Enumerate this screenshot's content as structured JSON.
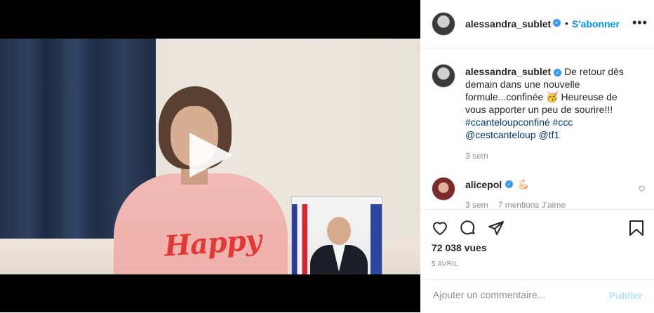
{
  "post": {
    "username": "alessandra_sublet",
    "follow_label": "S'abonner",
    "separator": "•",
    "more_label": "•••",
    "verified_glyph": "✓",
    "caption_text": "De retour dès demain dans une nouvelle formule...confinée 🥳 Heureuse de vous apporter un peu de sourire!!!",
    "caption_tags": "#ccanteloupconfiné #ccc @cestcanteloup @tf1",
    "caption_time": "3 sem"
  },
  "video": {
    "sweater_text": "Happy",
    "play_icon": "play-icon"
  },
  "comments": [
    {
      "username": "alicepol",
      "emoji": "💪🏻",
      "time": "3 sem",
      "likes": "7 mentions J'aime"
    }
  ],
  "actions": {
    "like_icon": "heart-icon",
    "comment_icon": "comment-bubble-icon",
    "share_icon": "paper-plane-icon",
    "save_icon": "bookmark-icon",
    "views": "72 038 vues",
    "date": "5 AVRIL"
  },
  "comment_box": {
    "placeholder": "Ajouter un commentaire...",
    "publish_label": "Publier"
  },
  "colors": {
    "accent": "#0095f6",
    "verified": "#3897f0",
    "publish_disabled": "#b2dffc"
  }
}
